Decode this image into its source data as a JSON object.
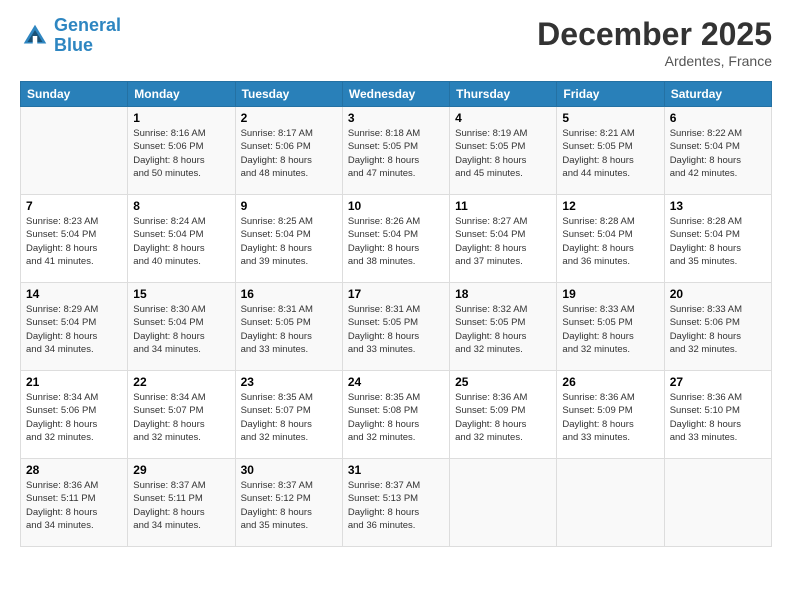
{
  "logo": {
    "line1": "General",
    "line2": "Blue"
  },
  "title": "December 2025",
  "subtitle": "Ardentes, France",
  "days_header": [
    "Sunday",
    "Monday",
    "Tuesday",
    "Wednesday",
    "Thursday",
    "Friday",
    "Saturday"
  ],
  "weeks": [
    [
      {
        "day": "",
        "info": ""
      },
      {
        "day": "1",
        "info": "Sunrise: 8:16 AM\nSunset: 5:06 PM\nDaylight: 8 hours\nand 50 minutes."
      },
      {
        "day": "2",
        "info": "Sunrise: 8:17 AM\nSunset: 5:06 PM\nDaylight: 8 hours\nand 48 minutes."
      },
      {
        "day": "3",
        "info": "Sunrise: 8:18 AM\nSunset: 5:05 PM\nDaylight: 8 hours\nand 47 minutes."
      },
      {
        "day": "4",
        "info": "Sunrise: 8:19 AM\nSunset: 5:05 PM\nDaylight: 8 hours\nand 45 minutes."
      },
      {
        "day": "5",
        "info": "Sunrise: 8:21 AM\nSunset: 5:05 PM\nDaylight: 8 hours\nand 44 minutes."
      },
      {
        "day": "6",
        "info": "Sunrise: 8:22 AM\nSunset: 5:04 PM\nDaylight: 8 hours\nand 42 minutes."
      }
    ],
    [
      {
        "day": "7",
        "info": "Sunrise: 8:23 AM\nSunset: 5:04 PM\nDaylight: 8 hours\nand 41 minutes."
      },
      {
        "day": "8",
        "info": "Sunrise: 8:24 AM\nSunset: 5:04 PM\nDaylight: 8 hours\nand 40 minutes."
      },
      {
        "day": "9",
        "info": "Sunrise: 8:25 AM\nSunset: 5:04 PM\nDaylight: 8 hours\nand 39 minutes."
      },
      {
        "day": "10",
        "info": "Sunrise: 8:26 AM\nSunset: 5:04 PM\nDaylight: 8 hours\nand 38 minutes."
      },
      {
        "day": "11",
        "info": "Sunrise: 8:27 AM\nSunset: 5:04 PM\nDaylight: 8 hours\nand 37 minutes."
      },
      {
        "day": "12",
        "info": "Sunrise: 8:28 AM\nSunset: 5:04 PM\nDaylight: 8 hours\nand 36 minutes."
      },
      {
        "day": "13",
        "info": "Sunrise: 8:28 AM\nSunset: 5:04 PM\nDaylight: 8 hours\nand 35 minutes."
      }
    ],
    [
      {
        "day": "14",
        "info": "Sunrise: 8:29 AM\nSunset: 5:04 PM\nDaylight: 8 hours\nand 34 minutes."
      },
      {
        "day": "15",
        "info": "Sunrise: 8:30 AM\nSunset: 5:04 PM\nDaylight: 8 hours\nand 34 minutes."
      },
      {
        "day": "16",
        "info": "Sunrise: 8:31 AM\nSunset: 5:05 PM\nDaylight: 8 hours\nand 33 minutes."
      },
      {
        "day": "17",
        "info": "Sunrise: 8:31 AM\nSunset: 5:05 PM\nDaylight: 8 hours\nand 33 minutes."
      },
      {
        "day": "18",
        "info": "Sunrise: 8:32 AM\nSunset: 5:05 PM\nDaylight: 8 hours\nand 32 minutes."
      },
      {
        "day": "19",
        "info": "Sunrise: 8:33 AM\nSunset: 5:05 PM\nDaylight: 8 hours\nand 32 minutes."
      },
      {
        "day": "20",
        "info": "Sunrise: 8:33 AM\nSunset: 5:06 PM\nDaylight: 8 hours\nand 32 minutes."
      }
    ],
    [
      {
        "day": "21",
        "info": "Sunrise: 8:34 AM\nSunset: 5:06 PM\nDaylight: 8 hours\nand 32 minutes."
      },
      {
        "day": "22",
        "info": "Sunrise: 8:34 AM\nSunset: 5:07 PM\nDaylight: 8 hours\nand 32 minutes."
      },
      {
        "day": "23",
        "info": "Sunrise: 8:35 AM\nSunset: 5:07 PM\nDaylight: 8 hours\nand 32 minutes."
      },
      {
        "day": "24",
        "info": "Sunrise: 8:35 AM\nSunset: 5:08 PM\nDaylight: 8 hours\nand 32 minutes."
      },
      {
        "day": "25",
        "info": "Sunrise: 8:36 AM\nSunset: 5:09 PM\nDaylight: 8 hours\nand 32 minutes."
      },
      {
        "day": "26",
        "info": "Sunrise: 8:36 AM\nSunset: 5:09 PM\nDaylight: 8 hours\nand 33 minutes."
      },
      {
        "day": "27",
        "info": "Sunrise: 8:36 AM\nSunset: 5:10 PM\nDaylight: 8 hours\nand 33 minutes."
      }
    ],
    [
      {
        "day": "28",
        "info": "Sunrise: 8:36 AM\nSunset: 5:11 PM\nDaylight: 8 hours\nand 34 minutes."
      },
      {
        "day": "29",
        "info": "Sunrise: 8:37 AM\nSunset: 5:11 PM\nDaylight: 8 hours\nand 34 minutes."
      },
      {
        "day": "30",
        "info": "Sunrise: 8:37 AM\nSunset: 5:12 PM\nDaylight: 8 hours\nand 35 minutes."
      },
      {
        "day": "31",
        "info": "Sunrise: 8:37 AM\nSunset: 5:13 PM\nDaylight: 8 hours\nand 36 minutes."
      },
      {
        "day": "",
        "info": ""
      },
      {
        "day": "",
        "info": ""
      },
      {
        "day": "",
        "info": ""
      }
    ]
  ]
}
